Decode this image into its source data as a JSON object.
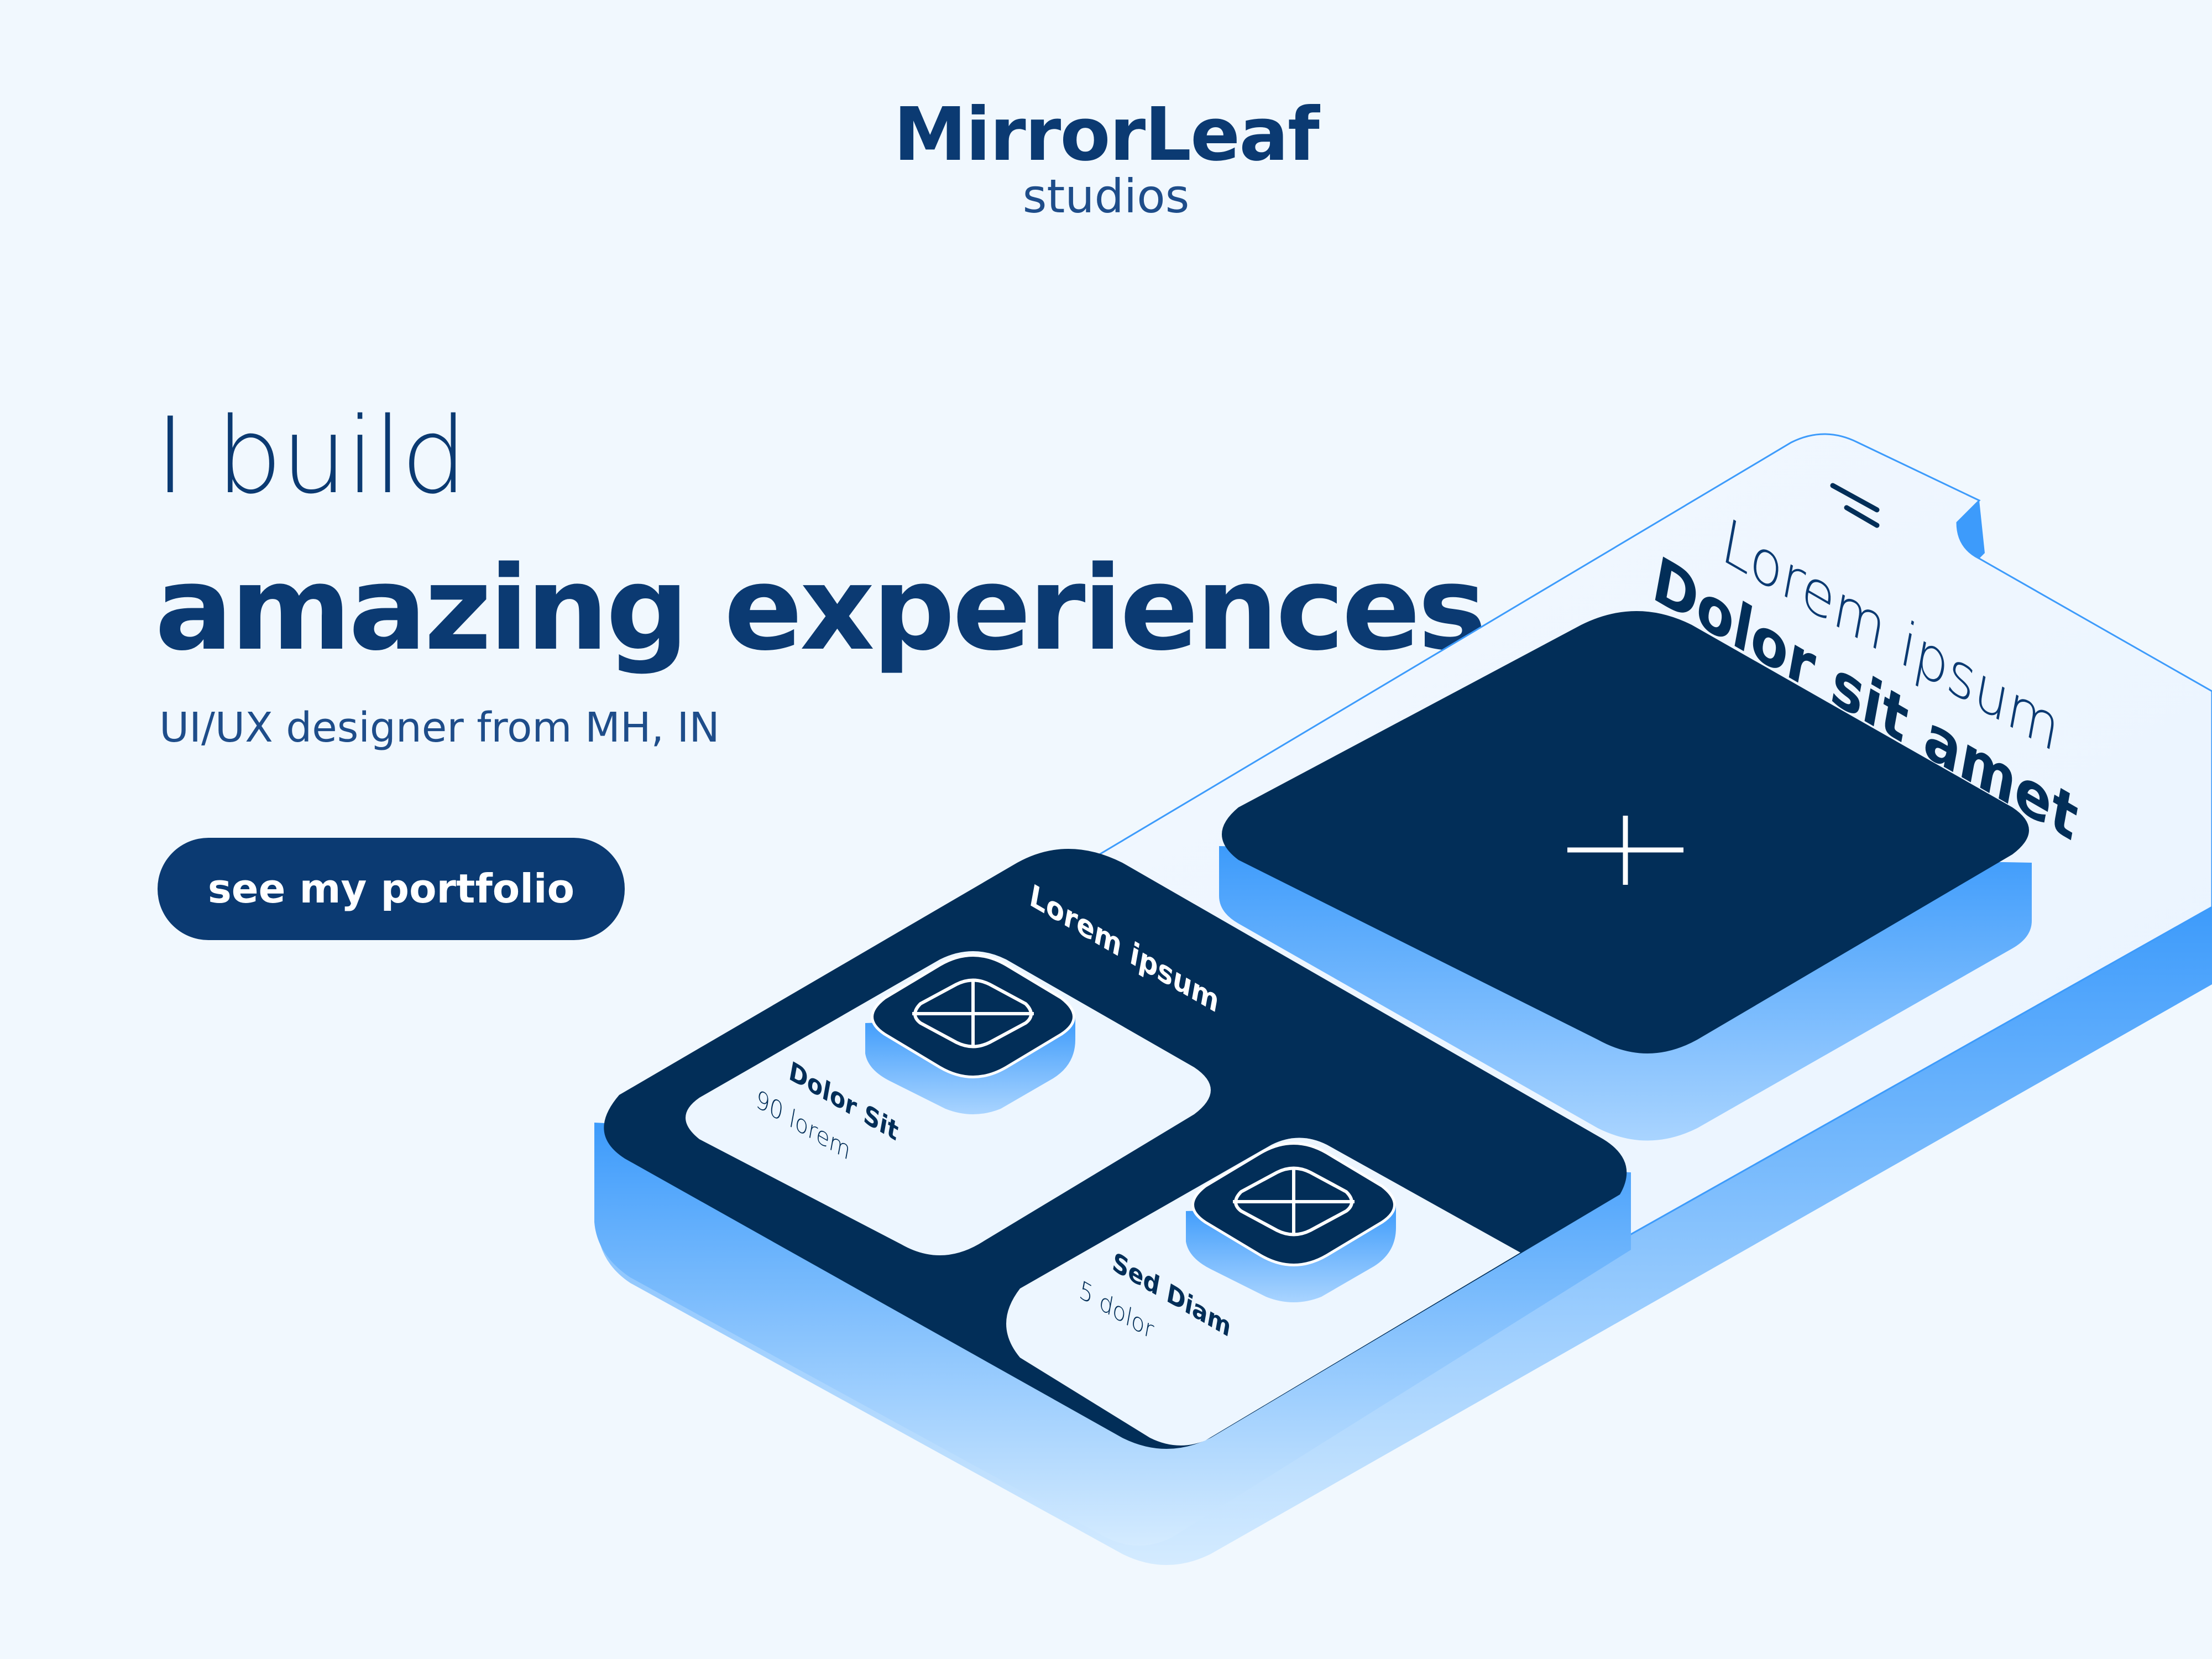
{
  "brand": {
    "name": "MirrorLeaf",
    "subtitle": "studios"
  },
  "hero": {
    "line1": "I build",
    "line2": "amazing experiences",
    "tagline": "UI/UX designer from MH, IN",
    "cta_label": "see my portfolio"
  },
  "phone": {
    "header_title": "Lorem ipsum",
    "header_subtitle": "Dolor sit amet",
    "panel_title": "Lorem ipsum",
    "cards": [
      {
        "title": "Dolor Sit",
        "subtitle": "90 lorem"
      },
      {
        "title": "Sed Diam",
        "subtitle": "5 dolor"
      }
    ]
  },
  "colors": {
    "background": "#f1f8fe",
    "brand_dark": "#0b3a72",
    "navy": "#022e58",
    "accent_blue": "#3d9bfb",
    "light_blue": "#bfe0ff",
    "card_light": "#edf6ff"
  },
  "icons": [
    "menu-icon",
    "plus-icon",
    "grid-cross-icon"
  ]
}
